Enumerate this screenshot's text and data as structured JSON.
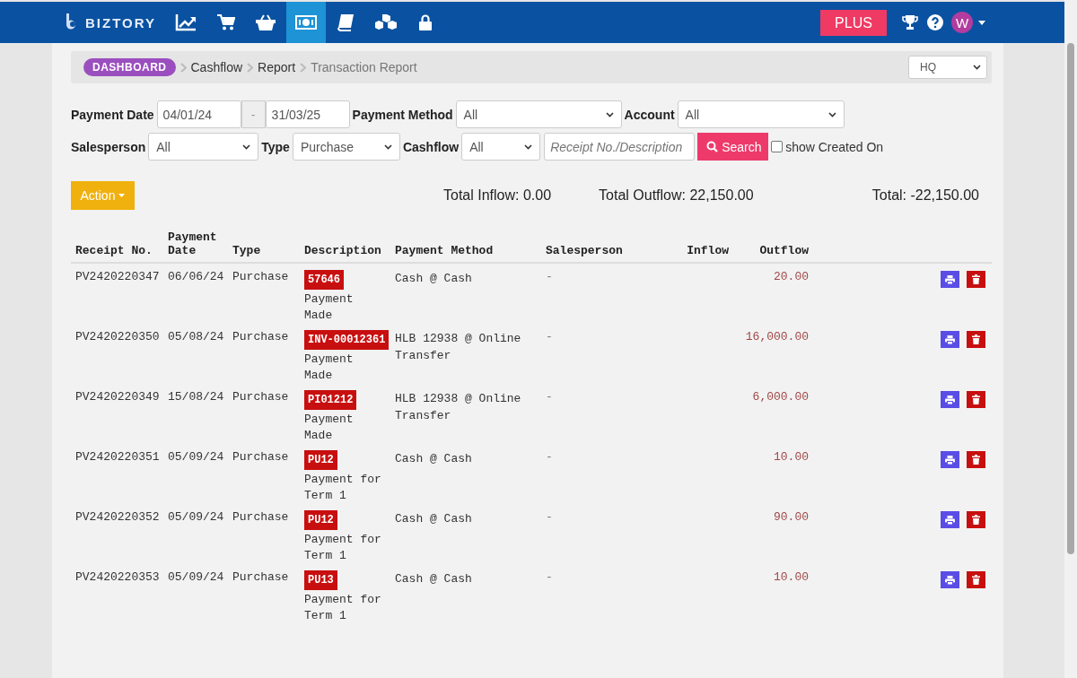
{
  "brand": "BIZTORY",
  "nav_items": [
    {
      "selected": false
    },
    {
      "selected": false
    },
    {
      "selected": false
    },
    {
      "selected": true
    },
    {
      "selected": false
    },
    {
      "selected": false
    },
    {
      "selected": false
    }
  ],
  "plus_button": "PLUS",
  "user_avatar": "W",
  "breadcrumb": [
    {
      "label": "DASHBOARD",
      "kind": "badge"
    },
    {
      "label": "Cashflow",
      "kind": "link"
    },
    {
      "label": "Report",
      "kind": "link"
    },
    {
      "label": "Transaction Report",
      "kind": "current"
    }
  ],
  "branch_select": "HQ",
  "filters": [
    [
      {
        "kind": "label",
        "text": "Payment Date"
      },
      {
        "kind": "input",
        "value": "04/01/24"
      },
      {
        "kind": "addon",
        "text": "-"
      },
      {
        "kind": "input",
        "value": "31/03/25"
      },
      {
        "kind": "label",
        "text": "Payment Method"
      },
      {
        "kind": "select",
        "value": "All"
      },
      {
        "kind": "label",
        "text": "Account"
      },
      {
        "kind": "select",
        "value": "All"
      }
    ],
    [
      {
        "kind": "label",
        "text": "Salesperson"
      },
      {
        "kind": "select",
        "value": "All"
      },
      {
        "kind": "label",
        "text": "Type"
      },
      {
        "kind": "select",
        "value": "Purchase"
      },
      {
        "kind": "label",
        "text": "Cashflow"
      },
      {
        "kind": "select",
        "value": "All"
      },
      {
        "kind": "search",
        "placeholder": "Receipt No./Description"
      },
      {
        "kind": "button",
        "text": "Search"
      },
      {
        "kind": "checkbox",
        "text": "show Created On",
        "checked": false
      }
    ]
  ],
  "action_button": "Action",
  "totals": [
    "Total Inflow: 0.00",
    "Total Outflow: 22,150.00",
    "Total: -22,150.00"
  ],
  "table": {
    "columns": [
      "Receipt No.",
      "Payment Date",
      "Type",
      "Description",
      "Payment Method",
      "Salesperson",
      "Inflow",
      "Outflow"
    ],
    "rows": [
      {
        "receipt_no": "PV2420220347",
        "payment_date": "06/06/24",
        "type": "Purchase",
        "tag": "57646",
        "description": "Payment Made",
        "payment_method": "Cash @ Cash",
        "salesperson": "-",
        "outflow": "20.00"
      },
      {
        "receipt_no": "PV2420220350",
        "payment_date": "05/08/24",
        "type": "Purchase",
        "tag": "INV-00012361",
        "description": "Payment Made",
        "payment_method": "HLB 12938 @ Online Transfer",
        "salesperson": "-",
        "outflow": "16,000.00"
      },
      {
        "receipt_no": "PV2420220349",
        "payment_date": "15/08/24",
        "type": "Purchase",
        "tag": "PI01212",
        "description": "Payment Made",
        "payment_method": "HLB 12938 @ Online Transfer",
        "salesperson": "-",
        "outflow": "6,000.00"
      },
      {
        "receipt_no": "PV2420220351",
        "payment_date": "05/09/24",
        "type": "Purchase",
        "tag": "PU12",
        "description": "Payment for Term 1",
        "payment_method": "Cash @ Cash",
        "salesperson": "-",
        "outflow": "10.00"
      },
      {
        "receipt_no": "PV2420220352",
        "payment_date": "05/09/24",
        "type": "Purchase",
        "tag": "PU12",
        "description": "Payment for Term 1",
        "payment_method": "Cash @ Cash",
        "salesperson": "-",
        "outflow": "90.00"
      },
      {
        "receipt_no": "PV2420220353",
        "payment_date": "05/09/24",
        "type": "Purchase",
        "tag": "PU13",
        "description": "Payment for Term 1",
        "payment_method": "Cash @ Cash",
        "salesperson": "-",
        "outflow": "10.00"
      }
    ]
  }
}
